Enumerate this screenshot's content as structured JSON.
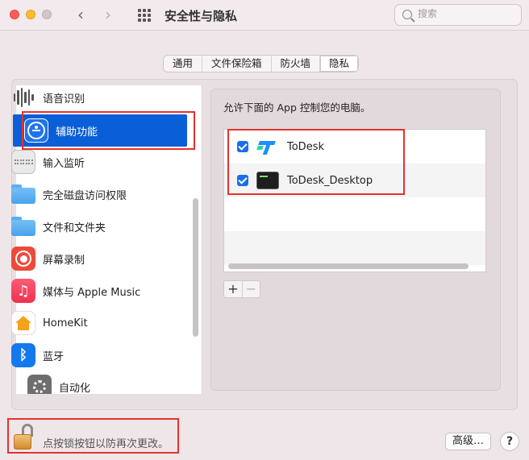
{
  "window": {
    "title": "安全性与隐私",
    "search_placeholder": "搜索"
  },
  "tabs": [
    {
      "label": "通用",
      "selected": false
    },
    {
      "label": "文件保险箱",
      "selected": false
    },
    {
      "label": "防火墙",
      "selected": false
    },
    {
      "label": "隐私",
      "selected": true
    }
  ],
  "sidebar": {
    "items": [
      {
        "label": "语音识别",
        "icon": "waveform-icon"
      },
      {
        "label": "辅助功能",
        "icon": "accessibility-icon",
        "selected": true
      },
      {
        "label": "输入监听",
        "icon": "keyboard-icon"
      },
      {
        "label": "完全磁盘访问权限",
        "icon": "folder-icon"
      },
      {
        "label": "文件和文件夹",
        "icon": "folder-icon"
      },
      {
        "label": "屏幕录制",
        "icon": "screen-record-icon"
      },
      {
        "label": "媒体与 Apple Music",
        "icon": "music-icon"
      },
      {
        "label": "HomeKit",
        "icon": "homekit-icon"
      },
      {
        "label": "蓝牙",
        "icon": "bluetooth-icon"
      },
      {
        "label": "自动化",
        "icon": "gear-icon"
      }
    ]
  },
  "panel": {
    "header": "允许下面的 App 控制您的电脑。",
    "apps": [
      {
        "name": "ToDesk",
        "checked": true,
        "icon": "todesk-icon"
      },
      {
        "name": "ToDesk_Desktop",
        "checked": true,
        "icon": "terminal-icon"
      }
    ],
    "add_label": "+",
    "remove_label": "−"
  },
  "footer": {
    "lock_text": "点按锁按钮以防再次更改。",
    "advanced_label": "高级…",
    "help_label": "?"
  },
  "colors": {
    "selection": "#0a5ed7",
    "highlight": "#e5322d",
    "checkbox": "#1a6ef0"
  }
}
